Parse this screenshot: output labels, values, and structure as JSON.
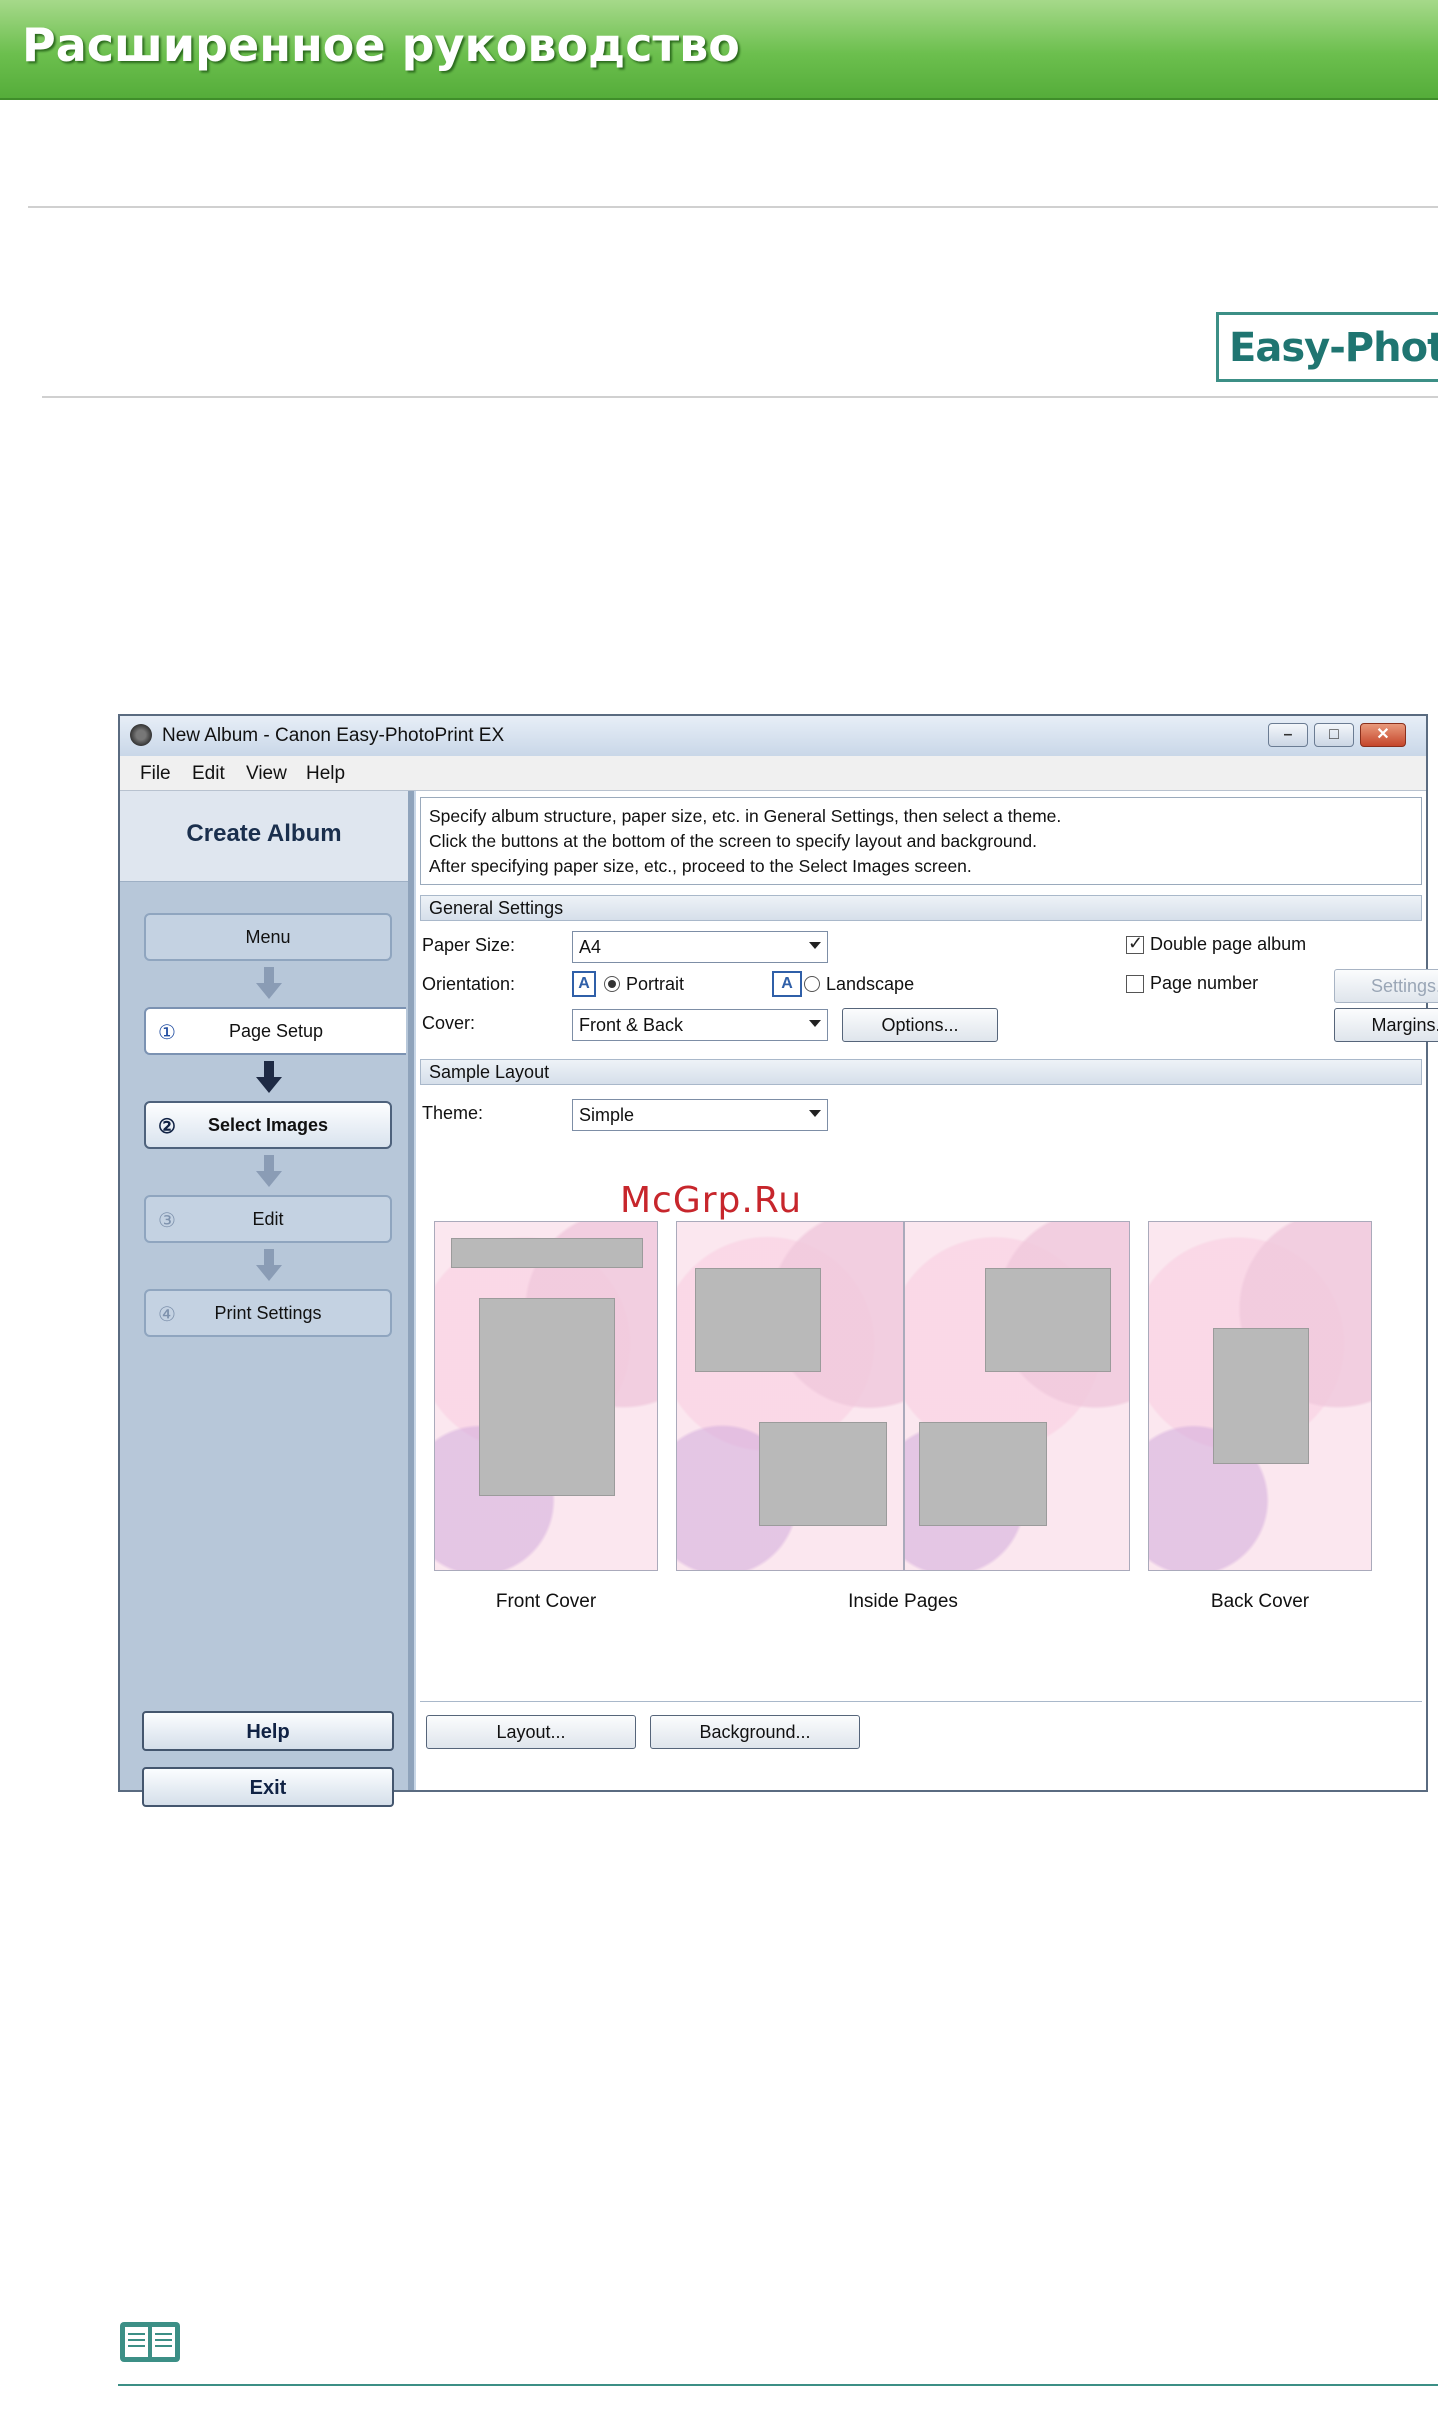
{
  "page": {
    "header_title": "Расширенное руководство",
    "product_badge": "Easy-PhotoP",
    "watermark": "McGrp.Ru"
  },
  "window": {
    "title": "New Album - Canon Easy-PhotoPrint EX",
    "controls": {
      "minimize": "–",
      "maximize": "□",
      "close": "✕"
    },
    "menu": [
      "File",
      "Edit",
      "View",
      "Help"
    ]
  },
  "left_pane": {
    "heading": "Create Album",
    "steps": [
      {
        "num": "",
        "label": "Menu"
      },
      {
        "num": "①",
        "label": "Page Setup"
      },
      {
        "num": "②",
        "label": "Select Images"
      },
      {
        "num": "③",
        "label": "Edit"
      },
      {
        "num": "④",
        "label": "Print Settings"
      }
    ],
    "help_label": "Help",
    "exit_label": "Exit"
  },
  "instructions": [
    "Specify album structure, paper size, etc. in General Settings, then select a theme.",
    "Click the buttons at the bottom of the screen to specify layout and background.",
    "After specifying paper size, etc., proceed to the Select Images screen."
  ],
  "general_settings": {
    "heading": "General Settings",
    "paper_size_label": "Paper Size:",
    "paper_size_value": "A4",
    "orientation_label": "Orientation:",
    "portrait_label": "Portrait",
    "landscape_label": "Landscape",
    "orientation_icon": "A",
    "cover_label": "Cover:",
    "cover_value": "Front & Back",
    "options_button": "Options...",
    "double_page_label": "Double page album",
    "double_page_checked": true,
    "page_number_label": "Page number",
    "page_number_checked": false,
    "settings_button": "Settings...",
    "margins_button": "Margins..."
  },
  "sample_layout": {
    "heading": "Sample Layout",
    "theme_label": "Theme:",
    "theme_value": "Simple",
    "captions": {
      "front": "Front Cover",
      "inside": "Inside Pages",
      "back": "Back Cover"
    },
    "layout_button": "Layout...",
    "background_button": "Background..."
  },
  "icons": [
    "app-icon",
    "arrow-down-icon",
    "orientation-portrait-icon",
    "orientation-landscape-icon",
    "note-book-icon"
  ],
  "colors": {
    "header_green": "#6cbf4e",
    "window_frame": "#5a6b80",
    "left_pane": "#b7c7d9",
    "badge_teal": "#1f7571"
  }
}
